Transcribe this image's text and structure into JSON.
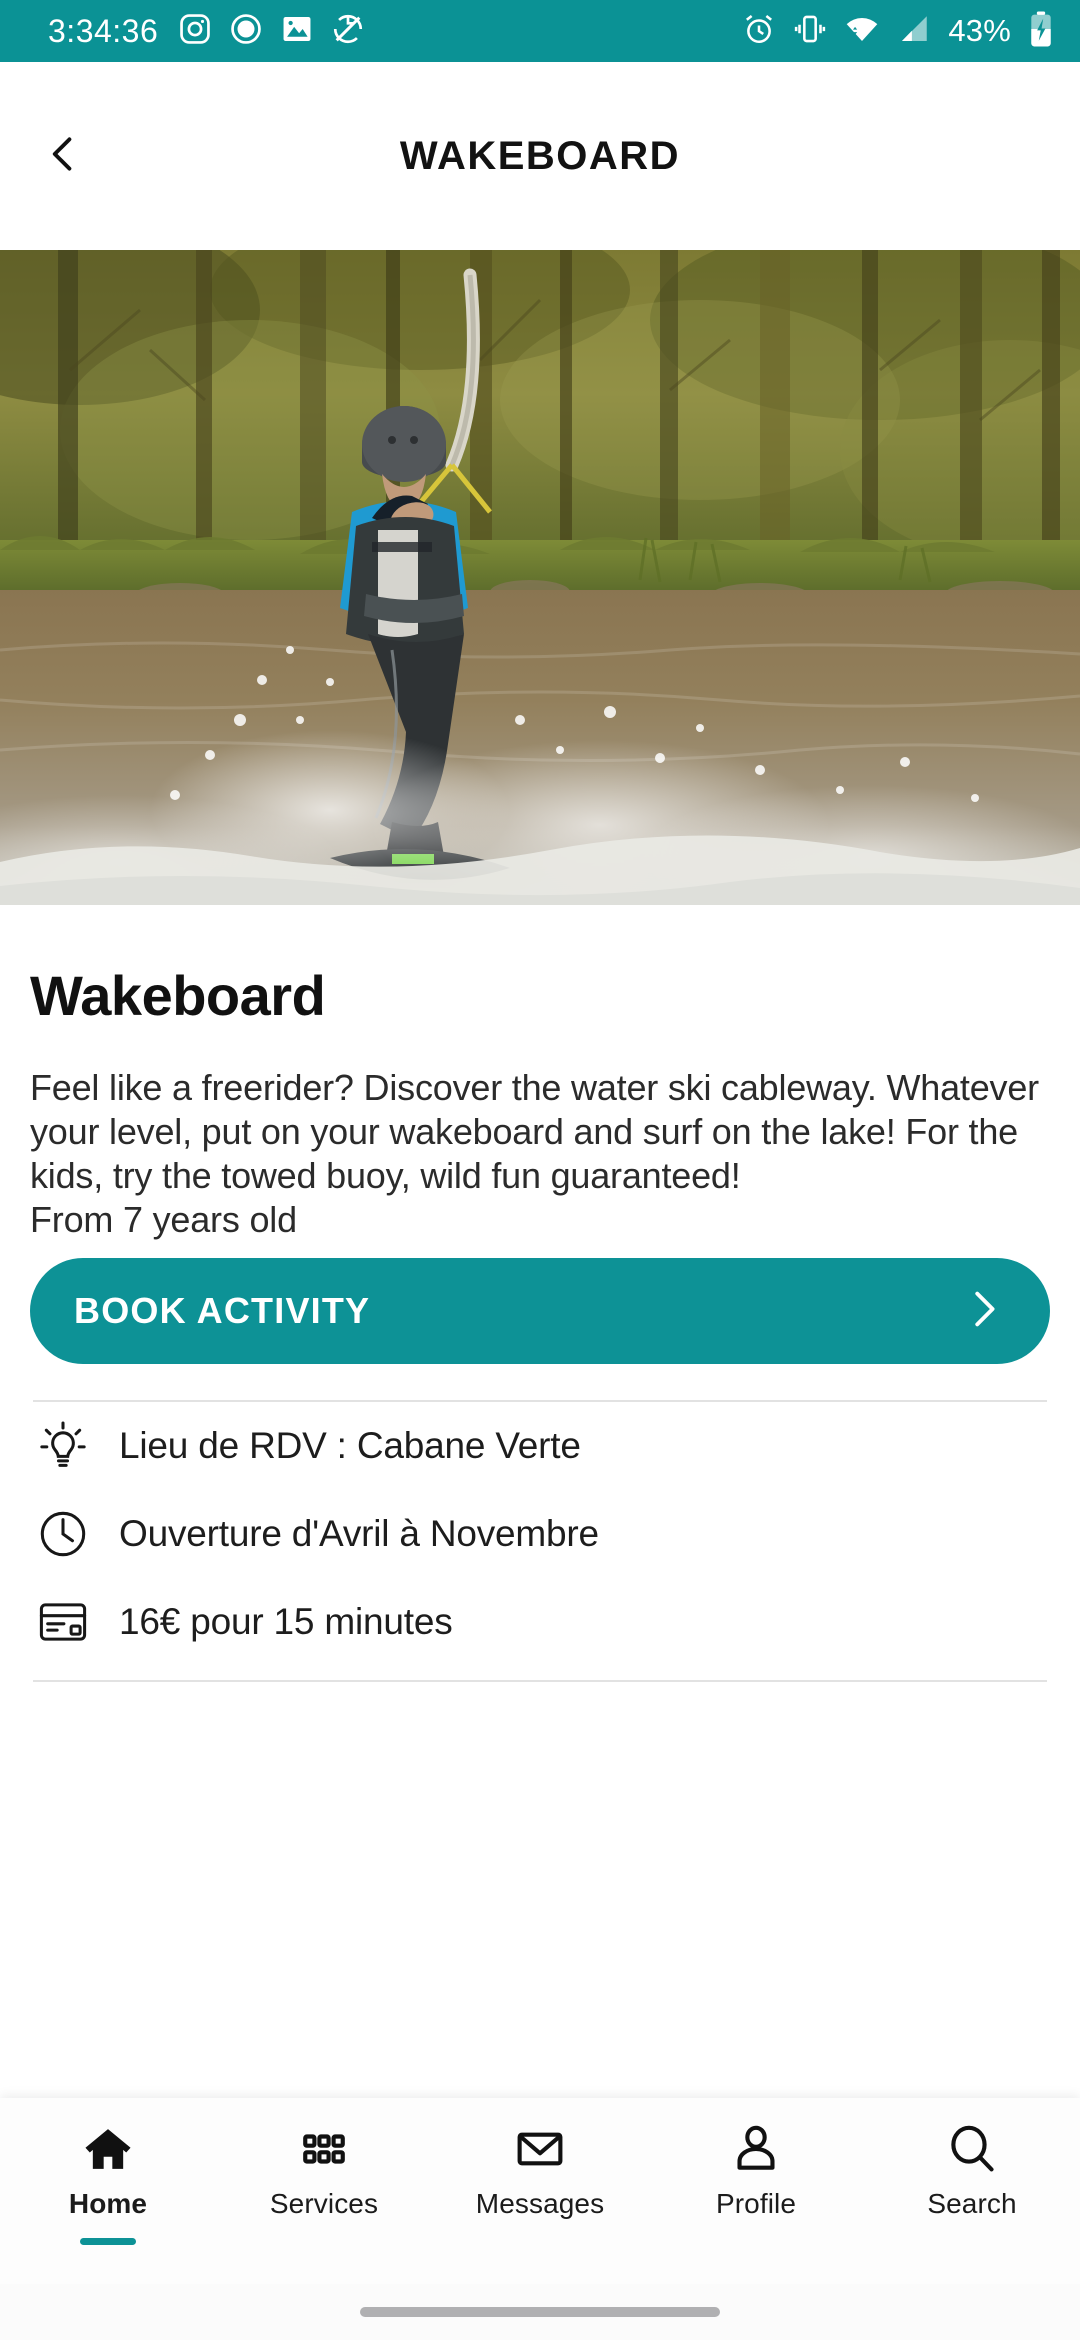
{
  "statusbar": {
    "time": "3:34:36",
    "battery_text": "43%",
    "left_icons": [
      "instagram-icon",
      "record-circle-icon",
      "photo-icon",
      "no-sync-icon"
    ],
    "right_icons": [
      "alarm-icon",
      "vibrate-icon",
      "wifi-icon",
      "cellular-signal-icon",
      "battery-charging-icon"
    ],
    "background_color": "#0b9295"
  },
  "appbar": {
    "title": "WAKEBOARD",
    "back_icon": "chevron-left-icon"
  },
  "hero": {
    "alt": "Wakeboarder riding across a lake with trees in the background"
  },
  "main": {
    "title": "Wakeboard",
    "description": "Feel like a freerider? Discover the water ski cableway. Whatever your level, put on your wakeboard and surf on the lake! For the kids, try the towed buoy, wild fun guaranteed!\nFrom 7 years old",
    "book_button": {
      "label": "BOOK ACTIVITY",
      "chevron": "chevron-right-icon",
      "color": "#0d9296"
    },
    "info_rows": [
      {
        "icon": "lightbulb-icon",
        "text": "Lieu de RDV : Cabane Verte"
      },
      {
        "icon": "clock-icon",
        "text": "Ouverture d'Avril à Novembre"
      },
      {
        "icon": "credit-card-icon",
        "text": "16€ pour 15 minutes"
      }
    ]
  },
  "bottomnav": {
    "active_color": "#0d9296",
    "items": [
      {
        "label": "Home",
        "icon": "home-icon",
        "active": true
      },
      {
        "label": "Services",
        "icon": "grid-icon",
        "active": false
      },
      {
        "label": "Messages",
        "icon": "envelope-icon",
        "active": false
      },
      {
        "label": "Profile",
        "icon": "person-icon",
        "active": false
      },
      {
        "label": "Search",
        "icon": "search-icon",
        "active": false
      }
    ]
  }
}
